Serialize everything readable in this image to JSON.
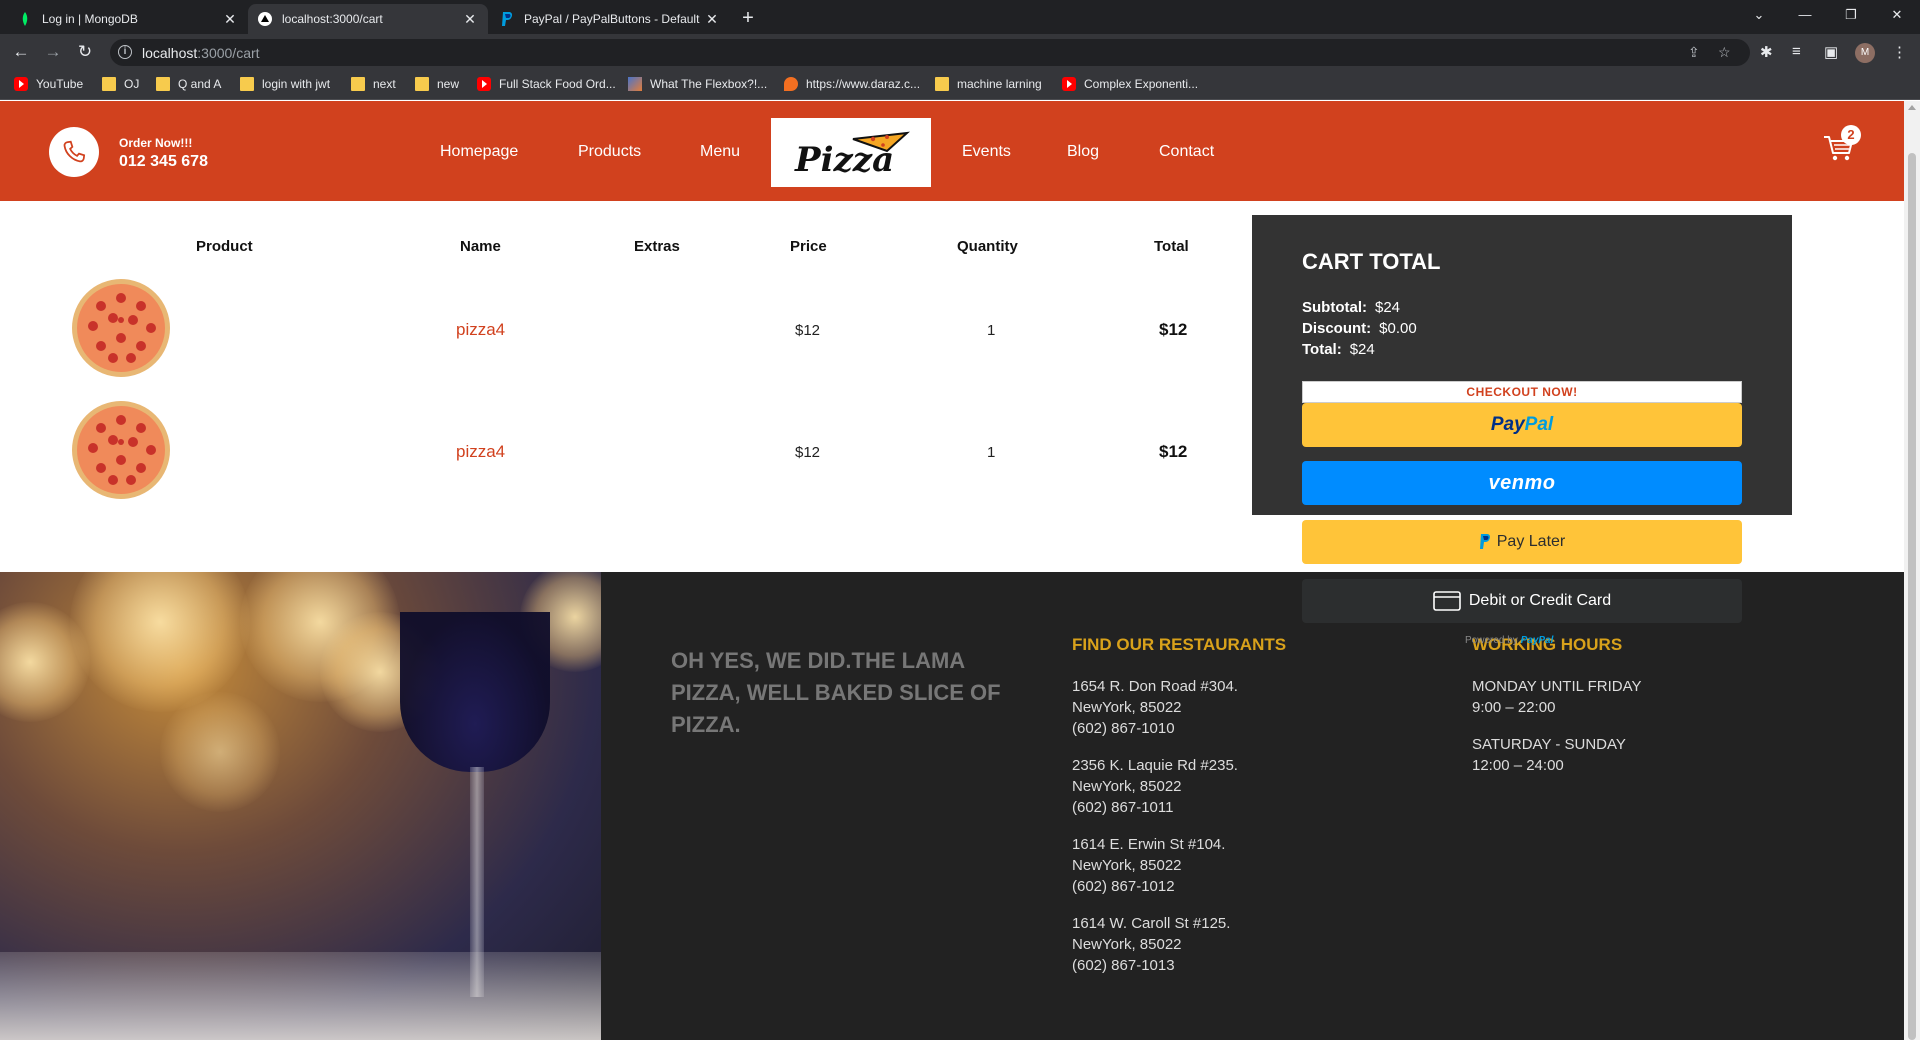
{
  "browser": {
    "tabs": [
      {
        "title": "Log in | MongoDB",
        "icon": "mongodb-leaf-icon",
        "active": false
      },
      {
        "title": "localhost:3000/cart",
        "icon": "nextjs-triangle-icon",
        "active": true
      },
      {
        "title": "PayPal / PayPalButtons - Default",
        "icon": "paypal-icon",
        "active": false
      }
    ],
    "url_host": "localhost",
    "url_path": ":3000/cart",
    "profile_initial": "M",
    "bookmarks": [
      {
        "label": "YouTube",
        "icon": "youtube-icon"
      },
      {
        "label": "OJ",
        "icon": "folder-icon"
      },
      {
        "label": "Q and A",
        "icon": "folder-icon"
      },
      {
        "label": "login with jwt",
        "icon": "folder-icon"
      },
      {
        "label": "next",
        "icon": "folder-icon"
      },
      {
        "label": "new",
        "icon": "folder-icon"
      },
      {
        "label": "Full Stack Food Ord...",
        "icon": "youtube-icon"
      },
      {
        "label": "What The Flexbox?!...",
        "icon": "image-icon"
      },
      {
        "label": "https://www.daraz.c...",
        "icon": "daraz-icon"
      },
      {
        "label": "machine larning",
        "icon": "folder-icon"
      },
      {
        "label": "Complex Exponenti...",
        "icon": "youtube-icon"
      }
    ]
  },
  "nav": {
    "order_label": "Order Now!!!",
    "phone": "012 345 678",
    "menu_left": [
      "Homepage",
      "Products",
      "Menu"
    ],
    "menu_right": [
      "Events",
      "Blog",
      "Contact"
    ],
    "logo_text": "Pizza",
    "cart_count": "2",
    "brand_color": "#d1411e"
  },
  "cart": {
    "headers": [
      "Product",
      "Name",
      "Extras",
      "Price",
      "Quantity",
      "Total"
    ],
    "rows": [
      {
        "name": "pizza4",
        "extras": "",
        "price": "$12",
        "quantity": "1",
        "total": "$12"
      },
      {
        "name": "pizza4",
        "extras": "",
        "price": "$12",
        "quantity": "1",
        "total": "$12"
      }
    ]
  },
  "cart_total": {
    "title": "CART TOTAL",
    "subtotal_label": "Subtotal:",
    "subtotal": "$24",
    "discount_label": "Discount:",
    "discount": "$0.00",
    "total_label": "Total:",
    "total": "$24",
    "checkout_label": "CHECKOUT NOW!",
    "paypal_pay": "Pay",
    "paypal_pal": "Pal",
    "venmo": "venmo",
    "pay_later": "Pay Later",
    "card": "Debit or Credit Card",
    "powered_by": "Powered by",
    "powered_brand": "PayPal"
  },
  "footer": {
    "slogan": "OH YES, WE DID.THE LAMA PIZZA, WELL BAKED SLICE OF PIZZA.",
    "restaurants_title": "FIND OUR RESTAURANTS",
    "restaurants": [
      {
        "street": "1654 R. Don Road #304.",
        "city": "NewYork, 85022",
        "phone": "(602) 867-1010"
      },
      {
        "street": "2356 K. Laquie Rd #235.",
        "city": "NewYork, 85022",
        "phone": "(602) 867-1011"
      },
      {
        "street": "1614 E. Erwin St #104.",
        "city": "NewYork, 85022",
        "phone": "(602) 867-1012"
      },
      {
        "street": "1614 W. Caroll St #125.",
        "city": "NewYork, 85022",
        "phone": "(602) 867-1013"
      }
    ],
    "hours_title": "WORKING HOURS",
    "hours": [
      {
        "days": "MONDAY UNTIL FRIDAY",
        "time": "9:00 – 22:00"
      },
      {
        "days": "SATURDAY - SUNDAY",
        "time": "12:00 – 24:00"
      }
    ],
    "accent_color": "#d9a21b"
  }
}
